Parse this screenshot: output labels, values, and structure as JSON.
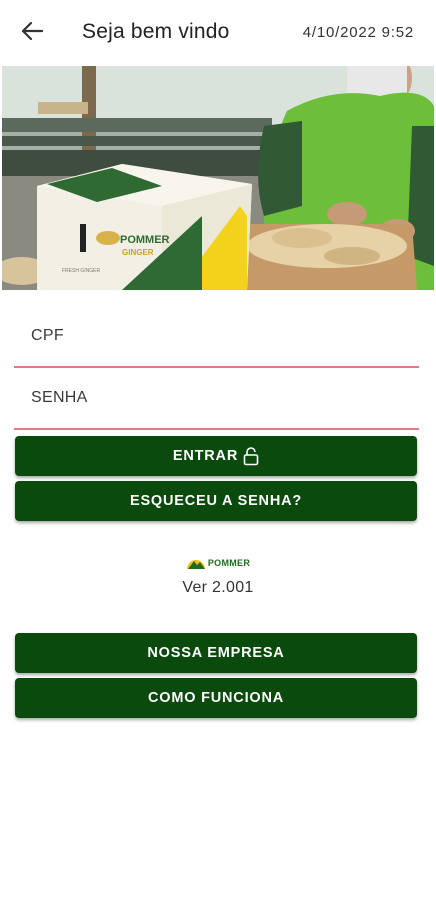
{
  "header": {
    "title": "Seja bem vindo",
    "datetime": "4/10/2022 9:52",
    "back_icon": "arrow-left-icon"
  },
  "hero": {
    "box_brand": "POMMER",
    "box_subbrand": "GINGER",
    "box_small": "FRESH GINGER"
  },
  "form": {
    "cpf_label": "CPF",
    "senha_label": "SENHA",
    "underline_color": "#e07a86"
  },
  "buttons": {
    "entrar": "ENTRAR",
    "esqueceu": "ESQUECEU A SENHA?",
    "empresa": "NOSSA EMPRESA",
    "funciona": "COMO FUNCIONA",
    "color": "#0a4a0d"
  },
  "footer": {
    "brand": "POMMER",
    "version": "Ver 2.001"
  }
}
